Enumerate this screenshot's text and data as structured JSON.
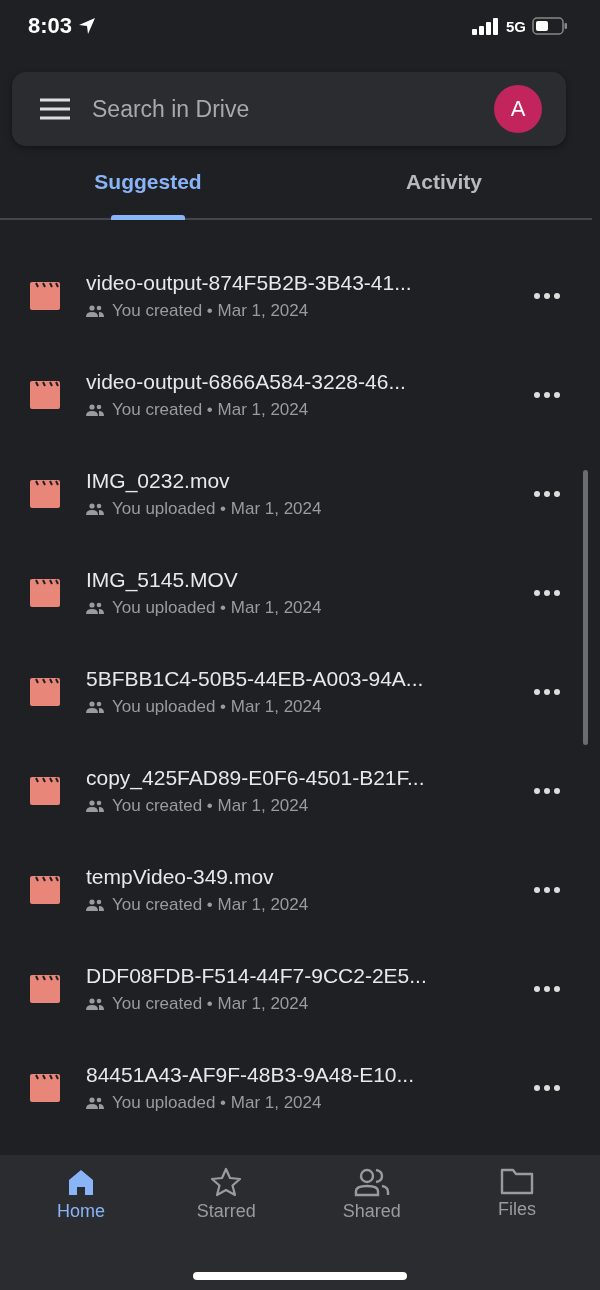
{
  "status_bar": {
    "time": "8:03",
    "network": "5G"
  },
  "search": {
    "placeholder": "Search in Drive",
    "avatar": "A"
  },
  "tabs": [
    {
      "label": "Suggested",
      "selected": true
    },
    {
      "label": "Activity",
      "selected": false
    }
  ],
  "files": [
    {
      "name": "video-output-874F5B2B-3B43-41...",
      "meta": "You created • Mar 1, 2024"
    },
    {
      "name": "video-output-6866A584-3228-46...",
      "meta": "You created • Mar 1, 2024"
    },
    {
      "name": "IMG_0232.mov",
      "meta": "You uploaded • Mar 1, 2024"
    },
    {
      "name": "IMG_5145.MOV",
      "meta": "You uploaded • Mar 1, 2024"
    },
    {
      "name": "5BFBB1C4-50B5-44EB-A003-94A...",
      "meta": "You uploaded • Mar 1, 2024"
    },
    {
      "name": "copy_425FAD89-E0F6-4501-B21F...",
      "meta": "You created • Mar 1, 2024"
    },
    {
      "name": "tempVideo-349.mov",
      "meta": "You created • Mar 1, 2024"
    },
    {
      "name": "DDF08FDB-F514-44F7-9CC2-2E5...",
      "meta": "You created • Mar 1, 2024"
    },
    {
      "name": "84451A43-AF9F-48B3-9A48-E10...",
      "meta": "You uploaded • Mar 1, 2024"
    }
  ],
  "nav": [
    {
      "label": "Home",
      "kind": "home",
      "selected": true
    },
    {
      "label": "Starred",
      "kind": "star",
      "selected": false
    },
    {
      "label": "Shared",
      "kind": "people",
      "selected": false
    },
    {
      "label": "Files",
      "kind": "folder",
      "selected": false
    }
  ]
}
